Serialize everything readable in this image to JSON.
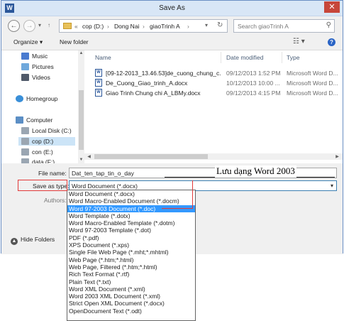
{
  "window": {
    "title": "Save As",
    "app_icon": "W"
  },
  "nav": {
    "address_prefix": "«",
    "breadcrumbs": [
      "cop (D:)",
      "Dong Nai",
      "giaoTrinh A"
    ],
    "search_placeholder": "Search giaoTrinh A"
  },
  "toolbar": {
    "organize": "Organize",
    "new_folder": "New folder"
  },
  "sidebar": {
    "items": [
      {
        "label": "Music",
        "icon": "music-icon"
      },
      {
        "label": "Pictures",
        "icon": "pictures-icon"
      },
      {
        "label": "Videos",
        "icon": "videos-icon"
      },
      {
        "label": "Homegroup",
        "icon": "homegroup-icon"
      },
      {
        "label": "Computer",
        "icon": "computer-icon"
      },
      {
        "label": "Local Disk (C:)",
        "icon": "drive-icon"
      },
      {
        "label": "cop (D:)",
        "icon": "drive-icon"
      },
      {
        "label": "con (E:)",
        "icon": "drive-icon"
      },
      {
        "label": "data (F:)",
        "icon": "drive-icon"
      }
    ]
  },
  "files": {
    "columns": [
      "Name",
      "Date modified",
      "Type"
    ],
    "rows": [
      {
        "name": "[09-12-2013_13.46.53]de_cuong_chung_c...",
        "date": "09/12/2013 1:52 PM",
        "type": "Microsoft Word D..."
      },
      {
        "name": "De_Cuong_Giao_trinh_A.docx",
        "date": "10/12/2013 10:00 ...",
        "type": "Microsoft Word D..."
      },
      {
        "name": "Giao Trinh Chung chi A_LBMy.docx",
        "date": "09/12/2013 4:15 PM",
        "type": "Microsoft Word D..."
      }
    ]
  },
  "form": {
    "file_name_label": "File name:",
    "file_name_value": "Dat_ten_tap_tin_o_day",
    "save_type_label": "Save as type:",
    "save_type_value": "Word Document (*.docx)",
    "authors_label": "Authors:",
    "hide_folders": "Hide Folders"
  },
  "dropdown": {
    "selected_index": 2,
    "options": [
      "Word Document (*.docx)",
      "Word Macro-Enabled Document (*.docm)",
      "Word 97-2003 Document (*.doc)",
      "Word Template (*.dotx)",
      "Word Macro-Enabled Template (*.dotm)",
      "Word 97-2003 Template (*.dot)",
      "PDF (*.pdf)",
      "XPS Document (*.xps)",
      "Single File Web Page (*.mht;*.mhtml)",
      "Web Page (*.htm;*.html)",
      "Web Page, Filtered (*.htm;*.html)",
      "Rich Text Format (*.rtf)",
      "Plain Text (*.txt)",
      "Word XML Document (*.xml)",
      "Word 2003 XML Document (*.xml)",
      "Strict Open XML Document (*.docx)",
      "OpenDocument Text (*.odt)"
    ]
  },
  "annotation": {
    "callout_text": "Lưu dạng Word 2003",
    "color": "#e23a3a"
  }
}
